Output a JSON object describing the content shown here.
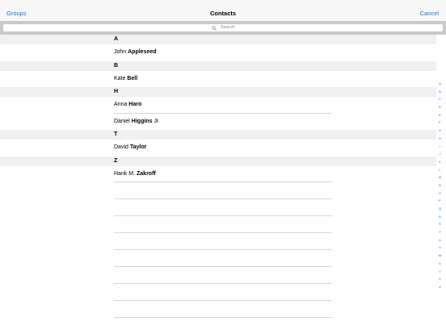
{
  "nav": {
    "left_label": "Groups",
    "title": "Contacts",
    "right_label": "Cancel"
  },
  "search": {
    "placeholder": "Search"
  },
  "sections": [
    {
      "header": "A",
      "contacts": [
        {
          "first": "John ",
          "last": "Appleseed",
          "suffix": ""
        }
      ]
    },
    {
      "header": "B",
      "contacts": [
        {
          "first": "Kate ",
          "last": "Bell",
          "suffix": ""
        }
      ]
    },
    {
      "header": "H",
      "contacts": [
        {
          "first": "Anna ",
          "last": "Haro",
          "suffix": ""
        },
        {
          "first": "Daniel ",
          "last": "Higgins",
          "suffix": " Jr."
        }
      ]
    },
    {
      "header": "T",
      "contacts": [
        {
          "first": "David ",
          "last": "Taylor",
          "suffix": ""
        }
      ]
    },
    {
      "header": "Z",
      "contacts": [
        {
          "first": "Hank M. ",
          "last": "Zakroff",
          "suffix": ""
        }
      ]
    }
  ],
  "index_letters": [
    "A",
    "B",
    "C",
    "D",
    "E",
    "F",
    "G",
    "H",
    "I",
    "J",
    "K",
    "L",
    "M",
    "N",
    "O",
    "P",
    "Q",
    "R",
    "S",
    "T",
    "U",
    "V",
    "W",
    "X",
    "Y",
    "Z",
    "#"
  ],
  "colors": {
    "accent": "#1a73e8",
    "section_bg": "#f0f0f0",
    "search_bar_bg": "#c9c9ce"
  }
}
